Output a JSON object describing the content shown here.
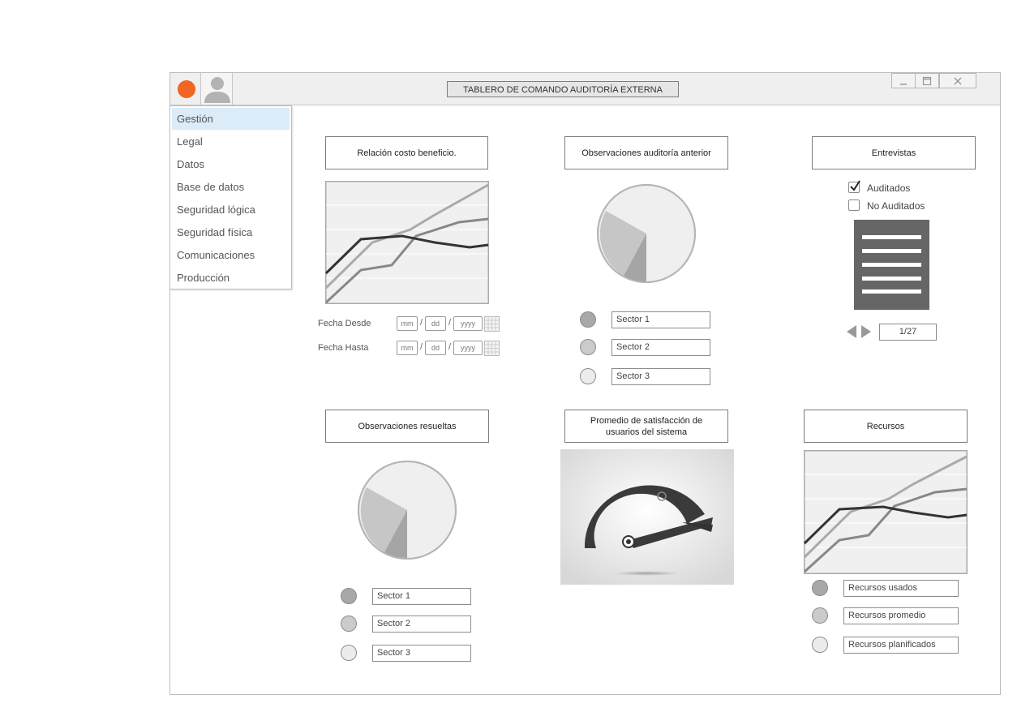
{
  "window": {
    "title": "TABLERO DE COMANDO AUDITORÍA EXTERNA",
    "controls": [
      "minimize",
      "maximize",
      "close"
    ]
  },
  "colors": {
    "accent": "#f26522",
    "menu_active": "#dcebf8",
    "dark_series": "#333333",
    "mid_series": "#888888",
    "light_series": "#aaaaaa"
  },
  "sidebar": {
    "items": [
      {
        "label": "Gestión",
        "active": true
      },
      {
        "label": "Legal"
      },
      {
        "label": "Datos"
      },
      {
        "label": "Base de datos"
      },
      {
        "label": "Seguridad lógica"
      },
      {
        "label": "Seguridad física"
      },
      {
        "label": "Comunicaciones"
      },
      {
        "label": "Producción"
      }
    ]
  },
  "panels": {
    "costo": {
      "title": "Relación costo beneficio.",
      "fecha_desde_label": "Fecha Desde",
      "fecha_hasta_label": "Fecha Hasta",
      "date_placeholders": {
        "mm": "mm",
        "dd": "dd",
        "yyyy": "yyyy"
      },
      "sep": "/"
    },
    "observaciones_anterior": {
      "title": "Observaciones auditoría anterior",
      "sectors": [
        "Sector 1",
        "Sector 2",
        "Sector 3"
      ]
    },
    "entrevistas": {
      "title": "Entrevistas",
      "auditados": "Auditados",
      "auditados_checked": true,
      "no_auditados": "No Auditados",
      "no_auditados_checked": false,
      "page": "1/27"
    },
    "observaciones_resueltas": {
      "title": "Observaciones resueltas",
      "sectors": [
        "Sector 1",
        "Sector 2",
        "Sector 3"
      ]
    },
    "satisfaccion": {
      "title_line1": "Promedio de satisfacción de",
      "title_line2": "usuarios del sistema"
    },
    "recursos": {
      "title": "Recursos",
      "legend": [
        "Recursos usados",
        "Recursos promedio",
        "Recursos planificados"
      ]
    }
  }
}
